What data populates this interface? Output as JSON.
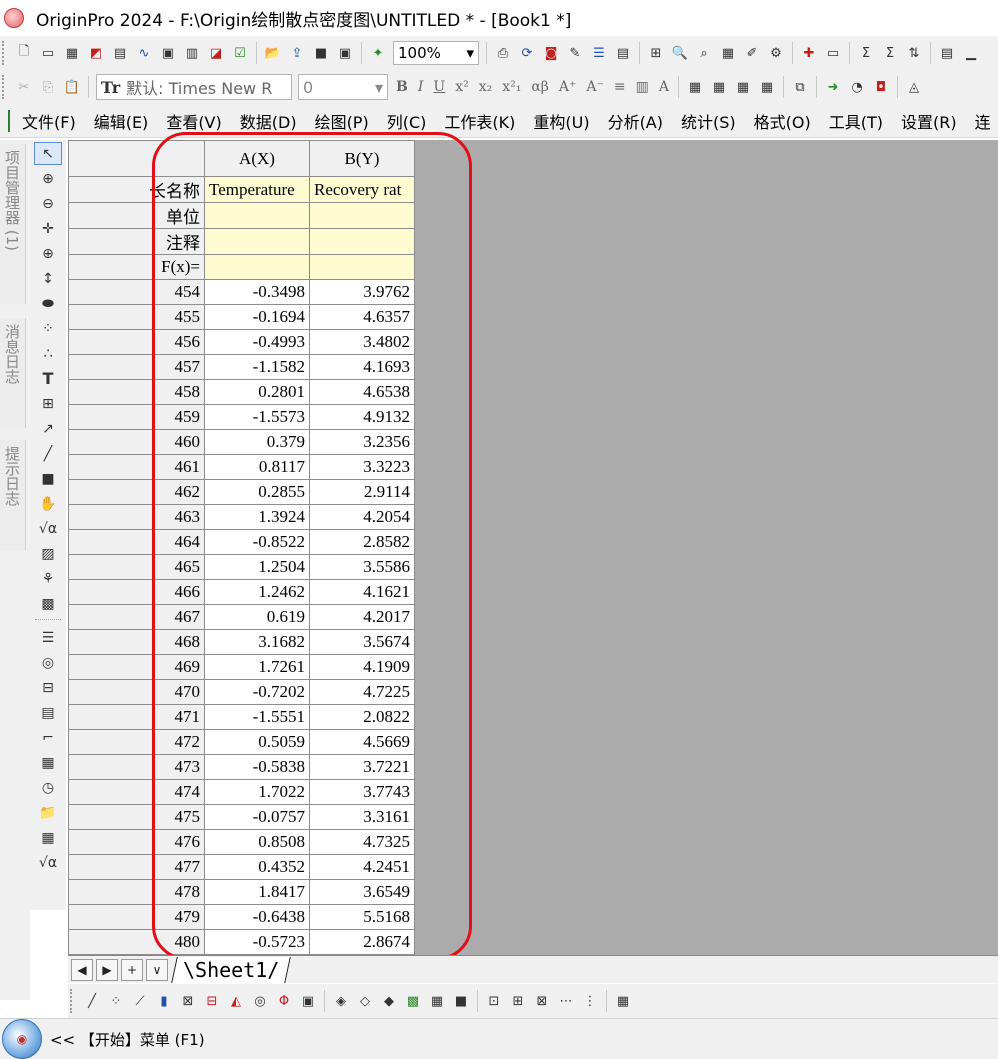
{
  "window": {
    "title": "OriginPro 2024 - F:\\Origin绘制散点密度图\\UNTITLED * - [Book1 *]"
  },
  "toolbar": {
    "zoom_value": "100%",
    "font_name": "默认: Times New R",
    "font_size": "0"
  },
  "menu": {
    "items": [
      "文件(F)",
      "编辑(E)",
      "查看(V)",
      "数据(D)",
      "绘图(P)",
      "列(C)",
      "工作表(K)",
      "重构(U)",
      "分析(A)",
      "统计(S)",
      "格式(O)",
      "工具(T)",
      "设置(R)",
      "连"
    ]
  },
  "side_panels": {
    "project_manager": "项目管理器 (1)",
    "message_log": "消息日志",
    "hint_log": "提示日志"
  },
  "worksheet": {
    "columns": [
      "A(X)",
      "B(Y)"
    ],
    "meta_rows": [
      {
        "label": "长名称",
        "values": [
          "Temperature",
          "Recovery rat"
        ]
      },
      {
        "label": "单位",
        "values": [
          "",
          ""
        ]
      },
      {
        "label": "注释",
        "values": [
          "",
          ""
        ]
      },
      {
        "label": "F(x)=",
        "values": [
          "",
          ""
        ]
      }
    ],
    "rows": [
      {
        "n": "454",
        "a": "-0.3498",
        "b": "3.9762"
      },
      {
        "n": "455",
        "a": "-0.1694",
        "b": "4.6357"
      },
      {
        "n": "456",
        "a": "-0.4993",
        "b": "3.4802"
      },
      {
        "n": "457",
        "a": "-1.1582",
        "b": "4.1693"
      },
      {
        "n": "458",
        "a": "0.2801",
        "b": "4.6538"
      },
      {
        "n": "459",
        "a": "-1.5573",
        "b": "4.9132"
      },
      {
        "n": "460",
        "a": "0.379",
        "b": "3.2356"
      },
      {
        "n": "461",
        "a": "0.8117",
        "b": "3.3223"
      },
      {
        "n": "462",
        "a": "0.2855",
        "b": "2.9114"
      },
      {
        "n": "463",
        "a": "1.3924",
        "b": "4.2054"
      },
      {
        "n": "464",
        "a": "-0.8522",
        "b": "2.8582"
      },
      {
        "n": "465",
        "a": "1.2504",
        "b": "3.5586"
      },
      {
        "n": "466",
        "a": "1.2462",
        "b": "4.1621"
      },
      {
        "n": "467",
        "a": "0.619",
        "b": "4.2017"
      },
      {
        "n": "468",
        "a": "3.1682",
        "b": "3.5674"
      },
      {
        "n": "469",
        "a": "1.7261",
        "b": "4.1909"
      },
      {
        "n": "470",
        "a": "-0.7202",
        "b": "4.7225"
      },
      {
        "n": "471",
        "a": "-1.5551",
        "b": "2.0822"
      },
      {
        "n": "472",
        "a": "0.5059",
        "b": "4.5669"
      },
      {
        "n": "473",
        "a": "-0.5838",
        "b": "3.7221"
      },
      {
        "n": "474",
        "a": "1.7022",
        "b": "3.7743"
      },
      {
        "n": "475",
        "a": "-0.0757",
        "b": "3.3161"
      },
      {
        "n": "476",
        "a": "0.8508",
        "b": "4.7325"
      },
      {
        "n": "477",
        "a": "0.4352",
        "b": "4.2451"
      },
      {
        "n": "478",
        "a": "1.8417",
        "b": "3.6549"
      },
      {
        "n": "479",
        "a": "-0.6438",
        "b": "5.5168"
      },
      {
        "n": "480",
        "a": "-0.5723",
        "b": "2.8674"
      }
    ]
  },
  "sheet_tabs": {
    "nav": [
      "◀",
      "▶",
      "+",
      "∨"
    ],
    "active": "\\Sheet1/"
  },
  "status": {
    "text": "<< 【开始】菜单 (F1)"
  },
  "colors": {
    "annotation": "#e0101a",
    "meta_row_bg": "#fdfbd0",
    "sheet_bg": "#ababab"
  }
}
